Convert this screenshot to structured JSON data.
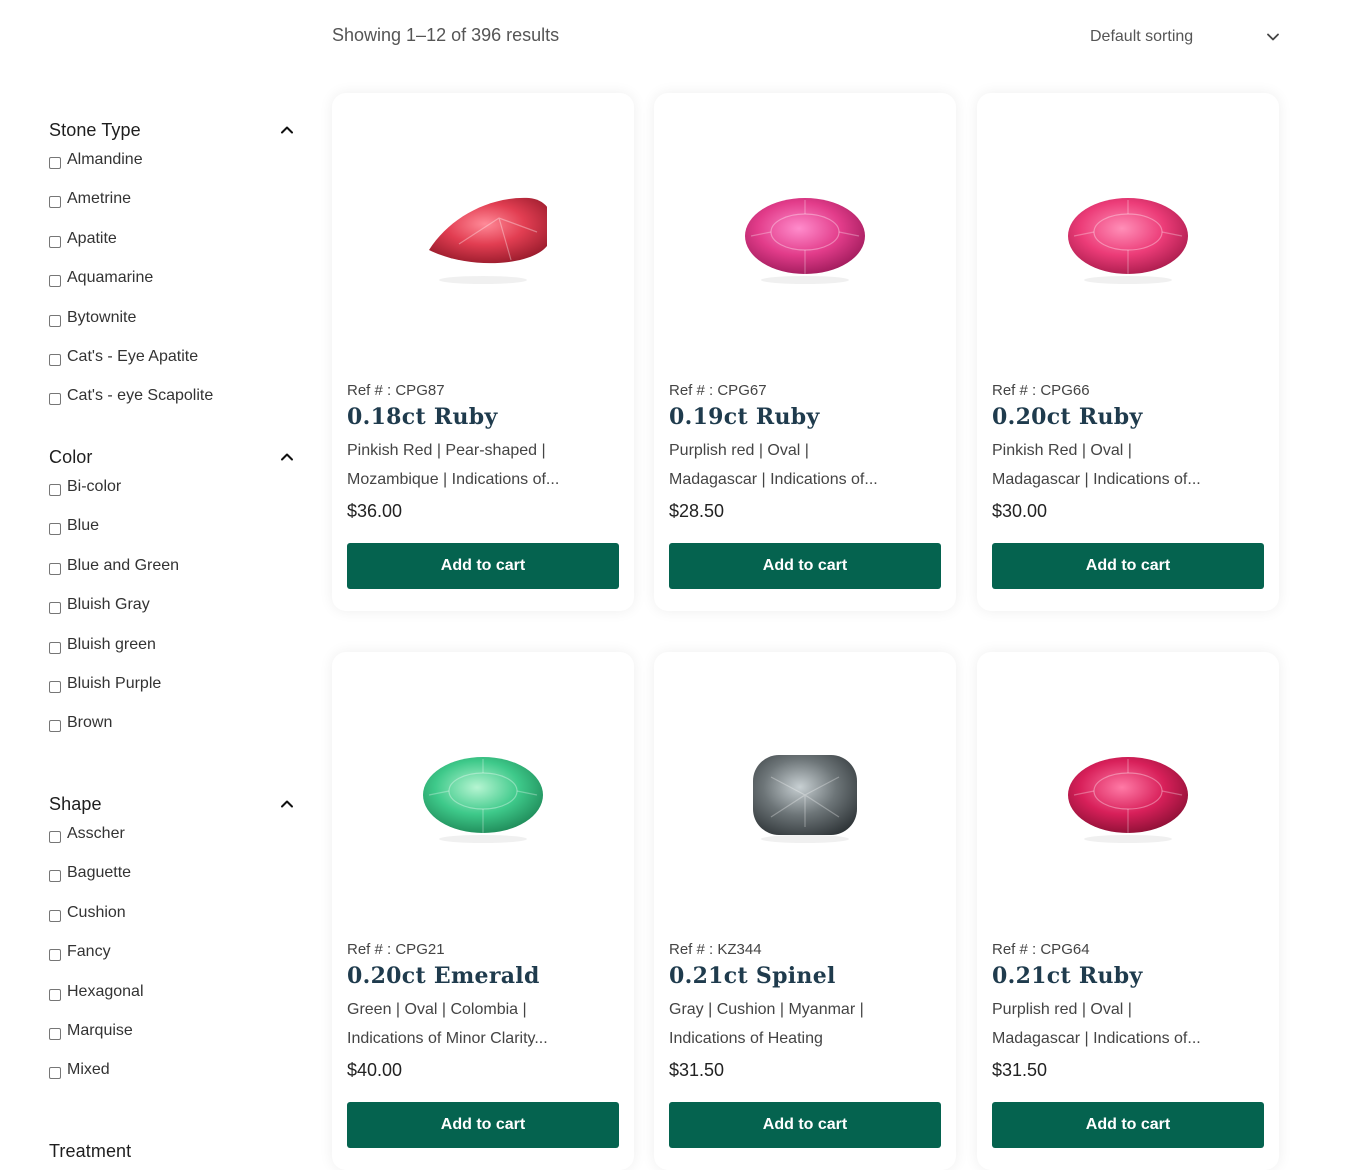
{
  "shop": {
    "result_count": "Showing 1–12 of 396 results",
    "sort_label": "Default sorting"
  },
  "filters": {
    "stone_type": {
      "title": "Stone Type",
      "options": [
        "Almandine",
        "Ametrine",
        "Apatite",
        "Aquamarine",
        "Bytownite",
        "Cat's - Eye Apatite",
        "Cat's - eye Scapolite"
      ]
    },
    "color": {
      "title": "Color",
      "options": [
        "Bi-color",
        "Blue",
        "Blue and Green",
        "Bluish Gray",
        "Bluish green",
        "Bluish Purple",
        "Brown"
      ]
    },
    "shape": {
      "title": "Shape",
      "options": [
        "Asscher",
        "Baguette",
        "Cushion",
        "Fancy",
        "Hexagonal",
        "Marquise",
        "Mixed"
      ]
    },
    "treatment": {
      "title": "Treatment"
    }
  },
  "products": [
    {
      "ref": "Ref # : CPG87",
      "name": "0.18ct Ruby",
      "desc_line1": "Pinkish Red | Pear-shaped |",
      "desc_line2": "Mozambique | Indications of...",
      "price": "$36.00",
      "button": "Add to cart",
      "stone_icon": "ruby-pear-gem",
      "color": "#e0405a"
    },
    {
      "ref": "Ref # : CPG67",
      "name": "0.19ct Ruby",
      "desc_line1": "Purplish red | Oval |",
      "desc_line2": "Madagascar | Indications of...",
      "price": "$28.50",
      "button": "Add to cart",
      "stone_icon": "ruby-oval-gem",
      "color": "#e23c88"
    },
    {
      "ref": "Ref # : CPG66",
      "name": "0.20ct Ruby",
      "desc_line1": "Pinkish Red | Oval |",
      "desc_line2": "Madagascar | Indications of...",
      "price": "$30.00",
      "button": "Add to cart",
      "stone_icon": "ruby-oval-gem",
      "color": "#ec3c78"
    },
    {
      "ref": "Ref # : CPG21",
      "name": "0.20ct Emerald",
      "desc_line1": "Green | Oval | Colombia |",
      "desc_line2": "Indications of Minor Clarity...",
      "price": "$40.00",
      "button": "Add to cart",
      "stone_icon": "emerald-oval-gem",
      "color": "#3ec98a"
    },
    {
      "ref": "Ref # : KZ344",
      "name": "0.21ct Spinel",
      "desc_line1": "Gray | Cushion | Myanmar |",
      "desc_line2": "Indications of Heating",
      "price": "$31.50",
      "button": "Add to cart",
      "stone_icon": "spinel-cushion-gem",
      "color": "#6d7578"
    },
    {
      "ref": "Ref # : CPG64",
      "name": "0.21ct Ruby",
      "desc_line1": "Purplish red | Oval |",
      "desc_line2": "Madagascar | Indications of...",
      "price": "$31.50",
      "button": "Add to cart",
      "stone_icon": "ruby-oval-gem",
      "color": "#d8205a"
    }
  ],
  "colors": {
    "button_bg": "#05634f",
    "product_name": "#1f3b4d"
  }
}
